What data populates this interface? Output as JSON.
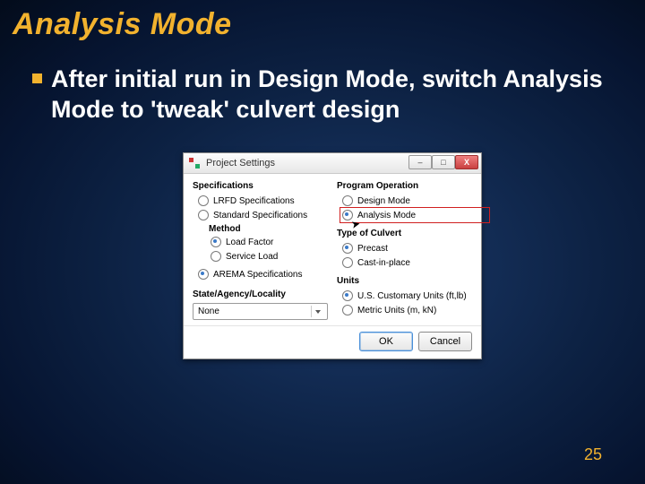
{
  "slide": {
    "title": "Analysis Mode",
    "bullet": "After initial run in Design Mode, switch Analysis Mode to 'tweak' culvert design",
    "page_number": "25"
  },
  "dialog": {
    "title": "Project Settings",
    "win_min": "–",
    "win_max": "□",
    "win_close": "X",
    "left": {
      "group": "Specifications",
      "opt_lrfd": "LRFD Specifications",
      "opt_std": "Standard Specifications",
      "method_label": "Method",
      "opt_load_factor": "Load Factor",
      "opt_service_load": "Service Load",
      "opt_arema": "AREMA Specifications",
      "state_label": "State/Agency/Locality",
      "dropdown_value": "None"
    },
    "right": {
      "group_op": "Program Operation",
      "opt_design": "Design Mode",
      "opt_analysis": "Analysis Mode",
      "group_type": "Type of Culvert",
      "opt_precast": "Precast",
      "opt_cip": "Cast-in-place",
      "group_units": "Units",
      "opt_us": "U.S. Customary Units (ft,lb)",
      "opt_metric": "Metric Units (m, kN)"
    },
    "buttons": {
      "ok": "OK",
      "cancel": "Cancel"
    }
  }
}
